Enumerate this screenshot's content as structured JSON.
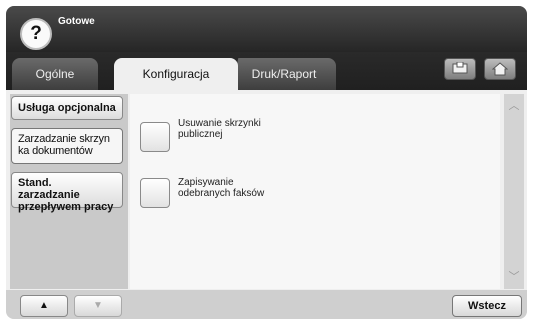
{
  "header": {
    "status": "Gotowe",
    "help_icon": "?"
  },
  "tabs": [
    {
      "label": "Ogólne"
    },
    {
      "label": "Konfiguracja"
    },
    {
      "label": "Druk/Raport"
    }
  ],
  "sidebar": {
    "items": [
      {
        "label": "Usługa opcjonalna"
      },
      {
        "label": "Zarzadzanie skrzyn ka dokumentów"
      },
      {
        "label": "Stand. zarzadzanie przepływem pracy"
      }
    ]
  },
  "options": [
    {
      "label": "Usuwanie skrzynki publicznej"
    },
    {
      "label": "Zapisywanie odebranych faksów"
    }
  ],
  "footer": {
    "up_glyph": "▲",
    "down_glyph": "▼",
    "back_label": "Wstecz"
  },
  "scroll": {
    "up_glyph": "︿",
    "down_glyph": "﹀"
  }
}
